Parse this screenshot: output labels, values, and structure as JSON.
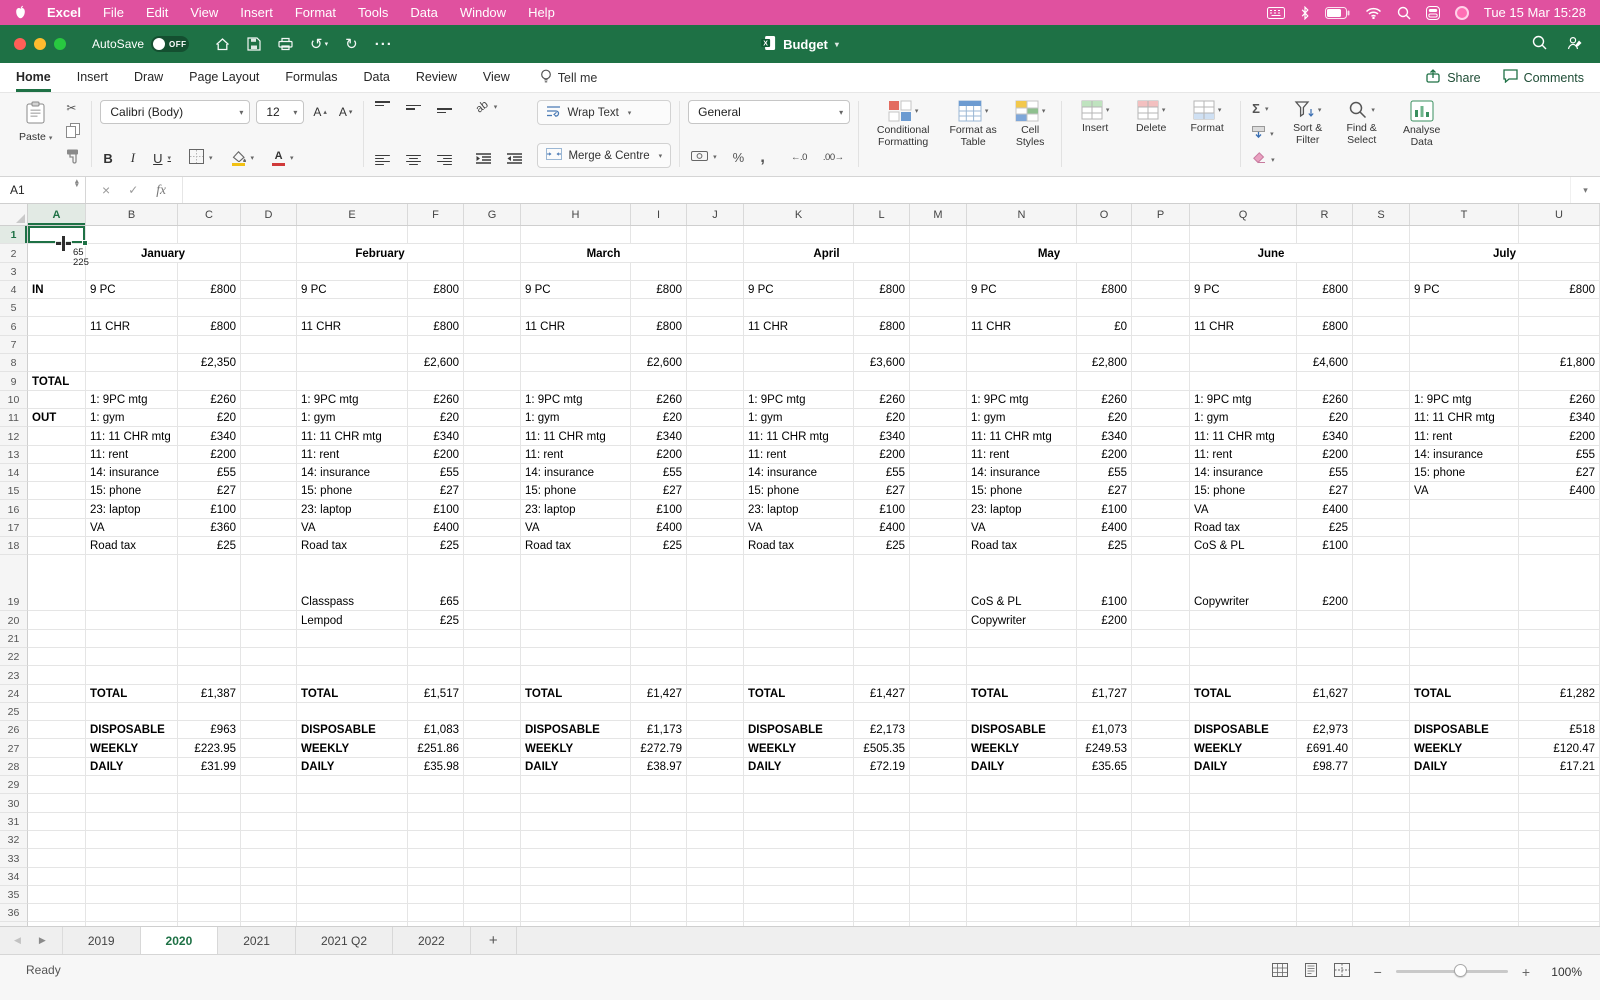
{
  "menu_bar": {
    "items": [
      "Excel",
      "File",
      "Edit",
      "View",
      "Insert",
      "Format",
      "Tools",
      "Data",
      "Window",
      "Help"
    ],
    "clock": "Tue 15 Mar 15:28"
  },
  "title_bar": {
    "autosave": "AutoSave",
    "autosave_state": "OFF",
    "title": "Budget"
  },
  "ribbon_tabs": {
    "tabs": [
      "Home",
      "Insert",
      "Draw",
      "Page Layout",
      "Formulas",
      "Data",
      "Review",
      "View"
    ],
    "active": "Home",
    "tell_me": "Tell me",
    "share": "Share",
    "comments": "Comments"
  },
  "ribbon": {
    "paste": "Paste",
    "font_name": "Calibri (Body)",
    "font_size": "12",
    "bold": "B",
    "italic": "I",
    "underline": "U",
    "wrap": "Wrap Text",
    "merge": "Merge & Centre",
    "number_format": "General",
    "cond": "Conditional Formatting",
    "fmt_table": "Format as Table",
    "cell_styles": "Cell Styles",
    "insert": "Insert",
    "delete": "Delete",
    "format": "Format",
    "sort": "Sort & Filter",
    "find": "Find & Select",
    "analyse": "Analyse Data"
  },
  "icons": {
    "scissors": "✂",
    "sigma": "Σ",
    "percent": "%",
    "comma": ",",
    "dec_inc": "←.0",
    "dec_dec": ".00→",
    "undo": "↺",
    "redo": "↻",
    "ellipsis": "···",
    "close_x": "×",
    "check": "✓",
    "letter_a": "A",
    "ab": "ab",
    "nav_left": "◀",
    "nav_right": "▶",
    "zoom_out": "−",
    "zoom_in": "+"
  },
  "formula_bar": {
    "name_box": "A1",
    "fx": "fx"
  },
  "cursor_artifact": {
    "line1": "65",
    "line2": "225"
  },
  "sheet": {
    "columns": [
      "A",
      "B",
      "C",
      "D",
      "E",
      "F",
      "G",
      "H",
      "I",
      "J",
      "K",
      "L",
      "M",
      "N",
      "O",
      "P",
      "Q",
      "R",
      "S",
      "T",
      "U"
    ],
    "row_count": 37,
    "selected_cell": "A1",
    "cells": [
      [
        "B",
        2,
        "January",
        "m"
      ],
      [
        "E",
        2,
        "February",
        "m"
      ],
      [
        "H",
        2,
        "March",
        "m"
      ],
      [
        "K",
        2,
        "April",
        "m"
      ],
      [
        "N",
        2,
        "May",
        "m"
      ],
      [
        "Q",
        2,
        "June",
        "m"
      ],
      [
        "T",
        2,
        "July",
        "m"
      ],
      [
        "A",
        4,
        "IN",
        "b"
      ],
      [
        "B",
        4,
        "9 PC",
        ""
      ],
      [
        "C",
        4,
        "£800",
        "n"
      ],
      [
        "E",
        4,
        "9 PC",
        ""
      ],
      [
        "F",
        4,
        "£800",
        "n"
      ],
      [
        "H",
        4,
        "9 PC",
        ""
      ],
      [
        "I",
        4,
        "£800",
        "n"
      ],
      [
        "K",
        4,
        "9 PC",
        ""
      ],
      [
        "L",
        4,
        "£800",
        "n"
      ],
      [
        "N",
        4,
        "9 PC",
        ""
      ],
      [
        "O",
        4,
        "£800",
        "n"
      ],
      [
        "Q",
        4,
        "9 PC",
        ""
      ],
      [
        "R",
        4,
        "£800",
        "n"
      ],
      [
        "T",
        4,
        "9 PC",
        ""
      ],
      [
        "U",
        4,
        "£800",
        "n"
      ],
      [
        "B",
        6,
        "11 CHR",
        ""
      ],
      [
        "C",
        6,
        "£800",
        "n"
      ],
      [
        "E",
        6,
        "11 CHR",
        ""
      ],
      [
        "F",
        6,
        "£800",
        "n"
      ],
      [
        "H",
        6,
        "11 CHR",
        ""
      ],
      [
        "I",
        6,
        "£800",
        "n"
      ],
      [
        "K",
        6,
        "11 CHR",
        ""
      ],
      [
        "L",
        6,
        "£800",
        "n"
      ],
      [
        "N",
        6,
        "11 CHR",
        ""
      ],
      [
        "O",
        6,
        "£0",
        "n"
      ],
      [
        "Q",
        6,
        "11 CHR",
        ""
      ],
      [
        "R",
        6,
        "£800",
        "n"
      ],
      [
        "C",
        8,
        "£2,350",
        "n"
      ],
      [
        "F",
        8,
        "£2,600",
        "n"
      ],
      [
        "I",
        8,
        "£2,600",
        "n"
      ],
      [
        "L",
        8,
        "£3,600",
        "n"
      ],
      [
        "O",
        8,
        "£2,800",
        "n"
      ],
      [
        "R",
        8,
        "£4,600",
        "n"
      ],
      [
        "U",
        8,
        "£1,800",
        "n"
      ],
      [
        "A",
        9,
        "TOTAL",
        "b"
      ],
      [
        "B",
        10,
        "1: 9PC mtg",
        ""
      ],
      [
        "C",
        10,
        "£260",
        "n"
      ],
      [
        "E",
        10,
        "1: 9PC mtg",
        ""
      ],
      [
        "F",
        10,
        "£260",
        "n"
      ],
      [
        "H",
        10,
        "1: 9PC mtg",
        ""
      ],
      [
        "I",
        10,
        "£260",
        "n"
      ],
      [
        "K",
        10,
        "1: 9PC mtg",
        ""
      ],
      [
        "L",
        10,
        "£260",
        "n"
      ],
      [
        "N",
        10,
        "1: 9PC mtg",
        ""
      ],
      [
        "O",
        10,
        "£260",
        "n"
      ],
      [
        "Q",
        10,
        "1: 9PC mtg",
        ""
      ],
      [
        "R",
        10,
        "£260",
        "n"
      ],
      [
        "T",
        10,
        "1: 9PC mtg",
        ""
      ],
      [
        "U",
        10,
        "£260",
        "n"
      ],
      [
        "A",
        11,
        "OUT",
        "b"
      ],
      [
        "B",
        11,
        "1: gym",
        ""
      ],
      [
        "C",
        11,
        "£20",
        "n"
      ],
      [
        "E",
        11,
        "1: gym",
        ""
      ],
      [
        "F",
        11,
        "£20",
        "n"
      ],
      [
        "H",
        11,
        "1: gym",
        ""
      ],
      [
        "I",
        11,
        "£20",
        "n"
      ],
      [
        "K",
        11,
        "1: gym",
        ""
      ],
      [
        "L",
        11,
        "£20",
        "n"
      ],
      [
        "N",
        11,
        "1: gym",
        ""
      ],
      [
        "O",
        11,
        "£20",
        "n"
      ],
      [
        "Q",
        11,
        "1: gym",
        ""
      ],
      [
        "R",
        11,
        "£20",
        "n"
      ],
      [
        "T",
        11,
        "11: 11 CHR mtg",
        ""
      ],
      [
        "U",
        11,
        "£340",
        "n"
      ],
      [
        "B",
        12,
        "11: 11 CHR mtg",
        ""
      ],
      [
        "C",
        12,
        "£340",
        "n"
      ],
      [
        "E",
        12,
        "11: 11 CHR mtg",
        ""
      ],
      [
        "F",
        12,
        "£340",
        "n"
      ],
      [
        "H",
        12,
        "11: 11 CHR mtg",
        ""
      ],
      [
        "I",
        12,
        "£340",
        "n"
      ],
      [
        "K",
        12,
        "11: 11 CHR mtg",
        ""
      ],
      [
        "L",
        12,
        "£340",
        "n"
      ],
      [
        "N",
        12,
        "11: 11 CHR mtg",
        ""
      ],
      [
        "O",
        12,
        "£340",
        "n"
      ],
      [
        "Q",
        12,
        "11: 11 CHR mtg",
        ""
      ],
      [
        "R",
        12,
        "£340",
        "n"
      ],
      [
        "T",
        12,
        "11: rent",
        ""
      ],
      [
        "U",
        12,
        "£200",
        "n"
      ],
      [
        "B",
        13,
        "11: rent",
        ""
      ],
      [
        "C",
        13,
        "£200",
        "n"
      ],
      [
        "E",
        13,
        "11: rent",
        ""
      ],
      [
        "F",
        13,
        "£200",
        "n"
      ],
      [
        "H",
        13,
        "11: rent",
        ""
      ],
      [
        "I",
        13,
        "£200",
        "n"
      ],
      [
        "K",
        13,
        "11: rent",
        ""
      ],
      [
        "L",
        13,
        "£200",
        "n"
      ],
      [
        "N",
        13,
        "11: rent",
        ""
      ],
      [
        "O",
        13,
        "£200",
        "n"
      ],
      [
        "Q",
        13,
        "11: rent",
        ""
      ],
      [
        "R",
        13,
        "£200",
        "n"
      ],
      [
        "T",
        13,
        "14: insurance",
        ""
      ],
      [
        "U",
        13,
        "£55",
        "n"
      ],
      [
        "B",
        14,
        "14: insurance",
        ""
      ],
      [
        "C",
        14,
        "£55",
        "n"
      ],
      [
        "E",
        14,
        "14: insurance",
        ""
      ],
      [
        "F",
        14,
        "£55",
        "n"
      ],
      [
        "H",
        14,
        "14: insurance",
        ""
      ],
      [
        "I",
        14,
        "£55",
        "n"
      ],
      [
        "K",
        14,
        "14: insurance",
        ""
      ],
      [
        "L",
        14,
        "£55",
        "n"
      ],
      [
        "N",
        14,
        "14: insurance",
        ""
      ],
      [
        "O",
        14,
        "£55",
        "n"
      ],
      [
        "Q",
        14,
        "14: insurance",
        ""
      ],
      [
        "R",
        14,
        "£55",
        "n"
      ],
      [
        "T",
        14,
        "15: phone",
        ""
      ],
      [
        "U",
        14,
        "£27",
        "n"
      ],
      [
        "B",
        15,
        "15: phone",
        ""
      ],
      [
        "C",
        15,
        "£27",
        "n"
      ],
      [
        "E",
        15,
        "15: phone",
        ""
      ],
      [
        "F",
        15,
        "£27",
        "n"
      ],
      [
        "H",
        15,
        "15: phone",
        ""
      ],
      [
        "I",
        15,
        "£27",
        "n"
      ],
      [
        "K",
        15,
        "15: phone",
        ""
      ],
      [
        "L",
        15,
        "£27",
        "n"
      ],
      [
        "N",
        15,
        "15: phone",
        ""
      ],
      [
        "O",
        15,
        "£27",
        "n"
      ],
      [
        "Q",
        15,
        "15: phone",
        ""
      ],
      [
        "R",
        15,
        "£27",
        "n"
      ],
      [
        "T",
        15,
        "VA",
        ""
      ],
      [
        "U",
        15,
        "£400",
        "n"
      ],
      [
        "B",
        16,
        "23: laptop",
        ""
      ],
      [
        "C",
        16,
        "£100",
        "n"
      ],
      [
        "E",
        16,
        "23: laptop",
        ""
      ],
      [
        "F",
        16,
        "£100",
        "n"
      ],
      [
        "H",
        16,
        "23: laptop",
        ""
      ],
      [
        "I",
        16,
        "£100",
        "n"
      ],
      [
        "K",
        16,
        "23: laptop",
        ""
      ],
      [
        "L",
        16,
        "£100",
        "n"
      ],
      [
        "N",
        16,
        "23: laptop",
        ""
      ],
      [
        "O",
        16,
        "£100",
        "n"
      ],
      [
        "Q",
        16,
        "VA",
        ""
      ],
      [
        "R",
        16,
        "£400",
        "n"
      ],
      [
        "B",
        17,
        "VA",
        ""
      ],
      [
        "C",
        17,
        "£360",
        "n"
      ],
      [
        "E",
        17,
        "VA",
        ""
      ],
      [
        "F",
        17,
        "£400",
        "n"
      ],
      [
        "H",
        17,
        "VA",
        ""
      ],
      [
        "I",
        17,
        "£400",
        "n"
      ],
      [
        "K",
        17,
        "VA",
        ""
      ],
      [
        "L",
        17,
        "£400",
        "n"
      ],
      [
        "N",
        17,
        "VA",
        ""
      ],
      [
        "O",
        17,
        "£400",
        "n"
      ],
      [
        "Q",
        17,
        "Road tax",
        ""
      ],
      [
        "R",
        17,
        "£25",
        "n"
      ],
      [
        "B",
        18,
        "Road tax",
        ""
      ],
      [
        "C",
        18,
        "£25",
        "n"
      ],
      [
        "E",
        18,
        "Road tax",
        ""
      ],
      [
        "F",
        18,
        "£25",
        "n"
      ],
      [
        "H",
        18,
        "Road tax",
        ""
      ],
      [
        "I",
        18,
        "£25",
        "n"
      ],
      [
        "K",
        18,
        "Road tax",
        ""
      ],
      [
        "L",
        18,
        "£25",
        "n"
      ],
      [
        "N",
        18,
        "Road tax",
        ""
      ],
      [
        "O",
        18,
        "£25",
        "n"
      ],
      [
        "Q",
        18,
        "CoS & PL",
        ""
      ],
      [
        "R",
        18,
        "£100",
        "n"
      ],
      [
        "E",
        19,
        "Classpass",
        ""
      ],
      [
        "F",
        19,
        "£65",
        "n"
      ],
      [
        "N",
        19,
        "CoS & PL",
        ""
      ],
      [
        "O",
        19,
        "£100",
        "n"
      ],
      [
        "Q",
        19,
        "Copywriter",
        ""
      ],
      [
        "R",
        19,
        "£200",
        "n"
      ],
      [
        "E",
        20,
        "Lempod",
        ""
      ],
      [
        "F",
        20,
        "£25",
        "n"
      ],
      [
        "N",
        20,
        "Copywriter",
        ""
      ],
      [
        "O",
        20,
        "£200",
        "n"
      ],
      [
        "B",
        24,
        "TOTAL",
        "b"
      ],
      [
        "C",
        24,
        "£1,387",
        "n"
      ],
      [
        "E",
        24,
        "TOTAL",
        "b"
      ],
      [
        "F",
        24,
        "£1,517",
        "n"
      ],
      [
        "H",
        24,
        "TOTAL",
        "b"
      ],
      [
        "I",
        24,
        "£1,427",
        "n"
      ],
      [
        "K",
        24,
        "TOTAL",
        "b"
      ],
      [
        "L",
        24,
        "£1,427",
        "n"
      ],
      [
        "N",
        24,
        "TOTAL",
        "b"
      ],
      [
        "O",
        24,
        "£1,727",
        "n"
      ],
      [
        "Q",
        24,
        "TOTAL",
        "b"
      ],
      [
        "R",
        24,
        "£1,627",
        "n"
      ],
      [
        "T",
        24,
        "TOTAL",
        "b"
      ],
      [
        "U",
        24,
        "£1,282",
        "n"
      ],
      [
        "B",
        26,
        "DISPOSABLE",
        "b"
      ],
      [
        "C",
        26,
        "£963",
        "n"
      ],
      [
        "E",
        26,
        "DISPOSABLE",
        "b"
      ],
      [
        "F",
        26,
        "£1,083",
        "n"
      ],
      [
        "H",
        26,
        "DISPOSABLE",
        "b"
      ],
      [
        "I",
        26,
        "£1,173",
        "n"
      ],
      [
        "K",
        26,
        "DISPOSABLE",
        "b"
      ],
      [
        "L",
        26,
        "£2,173",
        "n"
      ],
      [
        "N",
        26,
        "DISPOSABLE",
        "b"
      ],
      [
        "O",
        26,
        "£1,073",
        "n"
      ],
      [
        "Q",
        26,
        "DISPOSABLE",
        "b"
      ],
      [
        "R",
        26,
        "£2,973",
        "n"
      ],
      [
        "T",
        26,
        "DISPOSABLE",
        "b"
      ],
      [
        "U",
        26,
        "£518",
        "n"
      ],
      [
        "B",
        27,
        "WEEKLY",
        "b"
      ],
      [
        "C",
        27,
        "£223.95",
        "n"
      ],
      [
        "E",
        27,
        "WEEKLY",
        "b"
      ],
      [
        "F",
        27,
        "£251.86",
        "n"
      ],
      [
        "H",
        27,
        "WEEKLY",
        "b"
      ],
      [
        "I",
        27,
        "£272.79",
        "n"
      ],
      [
        "K",
        27,
        "WEEKLY",
        "b"
      ],
      [
        "L",
        27,
        "£505.35",
        "n"
      ],
      [
        "N",
        27,
        "WEEKLY",
        "b"
      ],
      [
        "O",
        27,
        "£249.53",
        "n"
      ],
      [
        "Q",
        27,
        "WEEKLY",
        "b"
      ],
      [
        "R",
        27,
        "£691.40",
        "n"
      ],
      [
        "T",
        27,
        "WEEKLY",
        "b"
      ],
      [
        "U",
        27,
        "£120.47",
        "n"
      ],
      [
        "B",
        28,
        "DAILY",
        "b"
      ],
      [
        "C",
        28,
        "£31.99",
        "n"
      ],
      [
        "E",
        28,
        "DAILY",
        "b"
      ],
      [
        "F",
        28,
        "£35.98",
        "n"
      ],
      [
        "H",
        28,
        "DAILY",
        "b"
      ],
      [
        "I",
        28,
        "£38.97",
        "n"
      ],
      [
        "K",
        28,
        "DAILY",
        "b"
      ],
      [
        "L",
        28,
        "£72.19",
        "n"
      ],
      [
        "N",
        28,
        "DAILY",
        "b"
      ],
      [
        "O",
        28,
        "£35.65",
        "n"
      ],
      [
        "Q",
        28,
        "DAILY",
        "b"
      ],
      [
        "R",
        28,
        "£98.77",
        "n"
      ],
      [
        "T",
        28,
        "DAILY",
        "b"
      ],
      [
        "U",
        28,
        "£17.21",
        "n"
      ]
    ]
  },
  "sheet_tabs": {
    "tabs": [
      "2019",
      "2020",
      "2021",
      "2021 Q2",
      "2022"
    ],
    "active": "2020",
    "add": "+"
  },
  "status_bar": {
    "mode": "Ready",
    "zoom": "100%"
  }
}
